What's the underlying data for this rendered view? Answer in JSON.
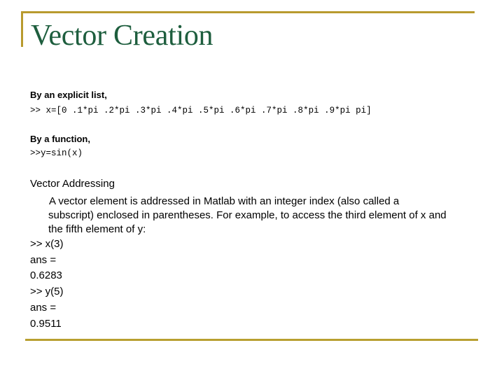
{
  "slide": {
    "title": "Vector Creation",
    "creation": {
      "explicit_label": "By an explicit list,",
      "explicit_code": ">> x=[0 .1*pi .2*pi .3*pi .4*pi .5*pi .6*pi .7*pi .8*pi .9*pi pi]",
      "function_label": "By a function,",
      "function_code": ">>y=sin(x)"
    },
    "addressing": {
      "heading": "Vector Addressing",
      "paragraph_lines": [
        "A vector element is addressed in Matlab with an integer index (also called a",
        "subscript) enclosed in parentheses. For example, to access the third element of x and",
        "the fifth element of y:"
      ],
      "console_lines": [
        ">> x(3)",
        "ans =",
        "0.6283",
        ">> y(5)",
        "ans =",
        "0.9511"
      ]
    },
    "colors": {
      "accent_rule": "#B89A2E",
      "title": "#1E5E3E"
    }
  }
}
